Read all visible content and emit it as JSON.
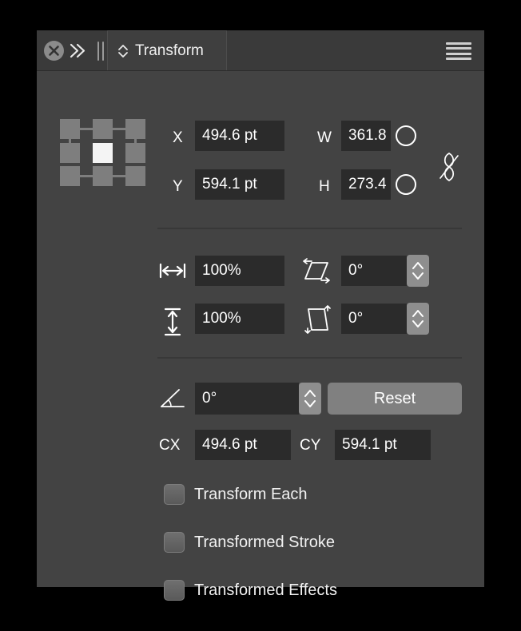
{
  "panel": {
    "titlebar": {
      "close_icon": "close-circle-icon",
      "collapse_icon": "double-chevron-right-icon",
      "drag_handle_icon": "drag-handle-icon",
      "menu_icon": "hamburger-menu-icon",
      "tab": {
        "label": "Transform",
        "chevron_icon": "up-down-chevron-icon"
      }
    },
    "reference_point": {
      "name": "reference-point-grid",
      "selected": "center",
      "cells": [
        "top-left",
        "top-center",
        "top-right",
        "middle-left",
        "center",
        "middle-right",
        "bottom-left",
        "bottom-center",
        "bottom-right"
      ]
    },
    "position": {
      "x_label": "X",
      "x_value": "494.6 pt",
      "y_label": "Y",
      "y_value": "594.1 pt",
      "w_label": "W",
      "w_value": "361.8",
      "h_label": "H",
      "h_value": "273.4",
      "w_lock_icon": "circle-icon",
      "h_lock_icon": "circle-icon",
      "link_icon": "broken-chain-link-icon"
    },
    "scale": {
      "horizontal_icon": "horizontal-scale-icon",
      "horizontal_value": "100%",
      "vertical_icon": "vertical-scale-icon",
      "vertical_value": "100%"
    },
    "shear": {
      "horizontal_icon": "horizontal-shear-icon",
      "horizontal_value": "0°",
      "vertical_icon": "vertical-shear-icon",
      "vertical_value": "0°",
      "stepper_icon": "up-down-stepper-icon"
    },
    "rotate": {
      "icon": "rotation-angle-icon",
      "value": "0°",
      "stepper_icon": "up-down-stepper-icon",
      "reset_label": "Reset"
    },
    "center": {
      "cx_label": "CX",
      "cx_value": "494.6 pt",
      "cy_label": "CY",
      "cy_value": "594.1 pt"
    },
    "options": [
      {
        "label": "Transform Each",
        "checked": false
      },
      {
        "label": "Transformed Stroke",
        "checked": false
      },
      {
        "label": "Transformed Effects",
        "checked": false
      }
    ]
  },
  "colors": {
    "panel_bg": "#434343",
    "titlebar_bg": "#3a3a3a",
    "input_bg": "#2b2b2b",
    "text": "#ffffff",
    "accent_selected": "#f4f4f4",
    "button_bg": "#808080"
  }
}
